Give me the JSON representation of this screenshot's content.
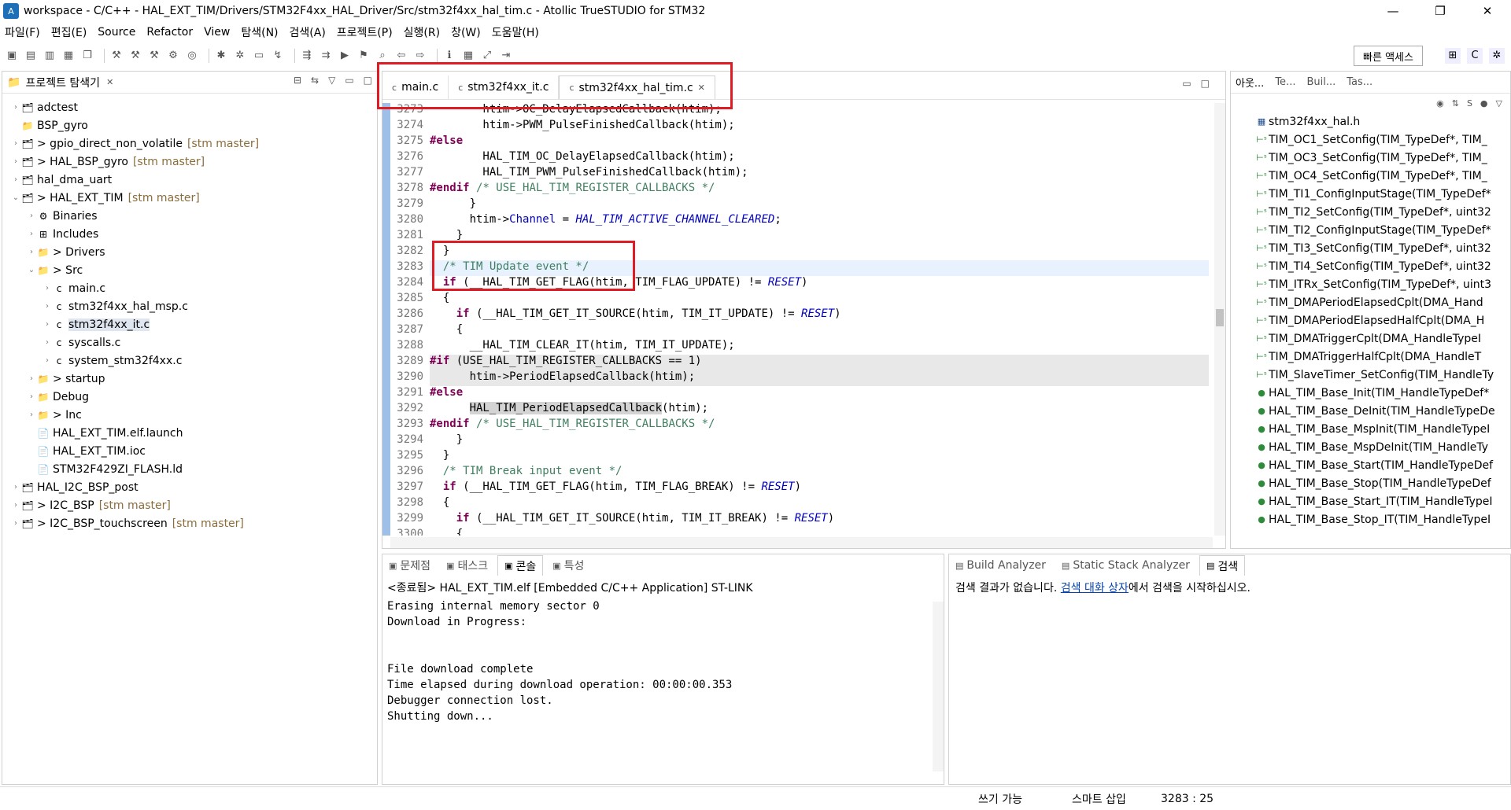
{
  "window": {
    "title": "workspace - C/C++ - HAL_EXT_TIM/Drivers/STM32F4xx_HAL_Driver/Src/stm32f4xx_hal_tim.c - Atollic TrueSTUDIO for STM32",
    "minimize": "—",
    "maximize": "❐",
    "close": "✕"
  },
  "menu": [
    "파일(F)",
    "편집(E)",
    "Source",
    "Refactor",
    "View",
    "탐색(N)",
    "검색(A)",
    "프로젝트(P)",
    "실행(R)",
    "창(W)",
    "도움말(H)"
  ],
  "toolbar": {
    "quick_access": "빠른 액세스"
  },
  "explorer": {
    "title": "프로젝트 탐색기",
    "items": [
      {
        "label": "adctest",
        "git": "",
        "arrow": "›",
        "icon": "project",
        "indent": 0
      },
      {
        "label": "BSP_gyro",
        "git": "",
        "arrow": "",
        "icon": "folder",
        "indent": 0
      },
      {
        "label": "> gpio_direct_non_volatile",
        "git": "[stm master]",
        "arrow": "›",
        "icon": "project",
        "indent": 0
      },
      {
        "label": "> HAL_BSP_gyro",
        "git": "[stm master]",
        "arrow": "›",
        "icon": "project",
        "indent": 0
      },
      {
        "label": "hal_dma_uart",
        "git": "",
        "arrow": "›",
        "icon": "project",
        "indent": 0
      },
      {
        "label": "> HAL_EXT_TIM",
        "git": "[stm master]",
        "arrow": "⌄",
        "icon": "project",
        "indent": 0
      },
      {
        "label": "Binaries",
        "git": "",
        "arrow": "›",
        "icon": "binaries",
        "indent": 1
      },
      {
        "label": "Includes",
        "git": "",
        "arrow": "›",
        "icon": "includes",
        "indent": 1
      },
      {
        "label": "> Drivers",
        "git": "",
        "arrow": "›",
        "icon": "folder",
        "indent": 1
      },
      {
        "label": "> Src",
        "git": "",
        "arrow": "⌄",
        "icon": "folder",
        "indent": 1
      },
      {
        "label": "main.c",
        "git": "",
        "arrow": "›",
        "icon": "cfile",
        "indent": 2
      },
      {
        "label": "stm32f4xx_hal_msp.c",
        "git": "",
        "arrow": "›",
        "icon": "cfile",
        "indent": 2
      },
      {
        "label": "stm32f4xx_it.c",
        "git": "",
        "arrow": "›",
        "icon": "cfile",
        "indent": 2,
        "selected": true
      },
      {
        "label": "syscalls.c",
        "git": "",
        "arrow": "›",
        "icon": "cfile",
        "indent": 2
      },
      {
        "label": "system_stm32f4xx.c",
        "git": "",
        "arrow": "›",
        "icon": "cfile",
        "indent": 2
      },
      {
        "label": "> startup",
        "git": "",
        "arrow": "›",
        "icon": "folder",
        "indent": 1
      },
      {
        "label": "Debug",
        "git": "",
        "arrow": "›",
        "icon": "folder",
        "indent": 1
      },
      {
        "label": "> Inc",
        "git": "",
        "arrow": "›",
        "icon": "folder",
        "indent": 1
      },
      {
        "label": "HAL_EXT_TIM.elf.launch",
        "git": "",
        "arrow": "",
        "icon": "file",
        "indent": 1
      },
      {
        "label": "HAL_EXT_TIM.ioc",
        "git": "",
        "arrow": "",
        "icon": "file",
        "indent": 1
      },
      {
        "label": "STM32F429ZI_FLASH.ld",
        "git": "",
        "arrow": "",
        "icon": "file",
        "indent": 1
      },
      {
        "label": "HAL_I2C_BSP_post",
        "git": "",
        "arrow": "›",
        "icon": "project",
        "indent": 0
      },
      {
        "label": "> I2C_BSP",
        "git": "[stm master]",
        "arrow": "›",
        "icon": "project",
        "indent": 0
      },
      {
        "label": "> I2C_BSP_touchscreen",
        "git": "[stm master]",
        "arrow": "›",
        "icon": "project",
        "indent": 0
      }
    ]
  },
  "editor": {
    "tabs": [
      {
        "label": "main.c",
        "active": false
      },
      {
        "label": "stm32f4xx_it.c",
        "active": false
      },
      {
        "label": "stm32f4xx_hal_tim.c",
        "active": true
      }
    ],
    "lines": [
      {
        "n": "3273",
        "html": "        htim->OC_DelayElapsedCallback(htim);",
        "hl": false
      },
      {
        "n": "3274",
        "html": "        htim->PWM_PulseFinishedCallback(htim);",
        "hl": false
      },
      {
        "n": "3275",
        "html": "<span class='pp'>#else</span>",
        "hl": false
      },
      {
        "n": "3276",
        "html": "        HAL_TIM_OC_DelayElapsedCallback(htim);",
        "hl": false
      },
      {
        "n": "3277",
        "html": "        HAL_TIM_PWM_PulseFinishedCallback(htim);",
        "hl": false
      },
      {
        "n": "3278",
        "html": "<span class='pp'>#endif</span> <span class='cm'>/* USE_HAL_TIM_REGISTER_CALLBACKS */</span>",
        "hl": false
      },
      {
        "n": "3279",
        "html": "      }",
        "hl": false
      },
      {
        "n": "3280",
        "html": "      htim-><span class='fld'>Channel</span> = <span class='mc'>HAL_TIM_ACTIVE_CHANNEL_CLEARED</span>;",
        "hl": false
      },
      {
        "n": "3281",
        "html": "    }",
        "hl": false
      },
      {
        "n": "3282",
        "html": "  }",
        "hl": false
      },
      {
        "n": "3283",
        "html": "  <span class='cm'>/* TIM Update event */</span>",
        "hl": false,
        "cur": true
      },
      {
        "n": "3284",
        "html": "  <span class='kw'>if</span> (__HAL_TIM_GET_FLAG(htim, TIM_FLAG_UPDATE) != <span class='mc'>RESET</span>)",
        "hl": false
      },
      {
        "n": "3285",
        "html": "  {",
        "hl": false
      },
      {
        "n": "3286",
        "html": "    <span class='kw'>if</span> (__HAL_TIM_GET_IT_SOURCE(htim, TIM_IT_UPDATE) != <span class='mc'>RESET</span>)",
        "hl": false
      },
      {
        "n": "3287",
        "html": "    {",
        "hl": false
      },
      {
        "n": "3288",
        "html": "      __HAL_TIM_CLEAR_IT(htim, TIM_IT_UPDATE);",
        "hl": false
      },
      {
        "n": "3289",
        "html": "<span class='pp'>#if</span> (USE_HAL_TIM_REGISTER_CALLBACKS == 1)",
        "hl": true
      },
      {
        "n": "3290",
        "html": "      htim->PeriodElapsedCallback(htim);",
        "hl": true
      },
      {
        "n": "3291",
        "html": "<span class='pp'>#else</span>",
        "hl": false
      },
      {
        "n": "3292",
        "html": "      <span style='background:#d4d4d4'>HAL_TIM_PeriodElapsedCallback</span>(htim);",
        "hl": false
      },
      {
        "n": "3293",
        "html": "<span class='pp'>#endif</span> <span class='cm'>/* USE_HAL_TIM_REGISTER_CALLBACKS */</span>",
        "hl": false
      },
      {
        "n": "3294",
        "html": "    }",
        "hl": false
      },
      {
        "n": "3295",
        "html": "  }",
        "hl": false
      },
      {
        "n": "3296",
        "html": "  <span class='cm'>/* TIM Break input event */</span>",
        "hl": false
      },
      {
        "n": "3297",
        "html": "  <span class='kw'>if</span> (__HAL_TIM_GET_FLAG(htim, TIM_FLAG_BREAK) != <span class='mc'>RESET</span>)",
        "hl": false
      },
      {
        "n": "3298",
        "html": "  {",
        "hl": false
      },
      {
        "n": "3299",
        "html": "    <span class='kw'>if</span> (__HAL_TIM_GET_IT_SOURCE(htim, TIM_IT_BREAK) != <span class='mc'>RESET</span>)",
        "hl": false
      },
      {
        "n": "3300",
        "html": "    {",
        "hl": false
      }
    ]
  },
  "outline": {
    "tabs": [
      "아웃...",
      "Te...",
      "Buil...",
      "Tas..."
    ],
    "items": [
      {
        "label": "stm32f4xx_hal.h",
        "type": "h"
      },
      {
        "label": "TIM_OC1_SetConfig(TIM_TypeDef*, TIM_",
        "type": "s"
      },
      {
        "label": "TIM_OC3_SetConfig(TIM_TypeDef*, TIM_",
        "type": "s"
      },
      {
        "label": "TIM_OC4_SetConfig(TIM_TypeDef*, TIM_",
        "type": "s"
      },
      {
        "label": "TIM_TI1_ConfigInputStage(TIM_TypeDef*",
        "type": "s"
      },
      {
        "label": "TIM_TI2_SetConfig(TIM_TypeDef*, uint32",
        "type": "s"
      },
      {
        "label": "TIM_TI2_ConfigInputStage(TIM_TypeDef*",
        "type": "s"
      },
      {
        "label": "TIM_TI3_SetConfig(TIM_TypeDef*, uint32",
        "type": "s"
      },
      {
        "label": "TIM_TI4_SetConfig(TIM_TypeDef*, uint32",
        "type": "s"
      },
      {
        "label": "TIM_ITRx_SetConfig(TIM_TypeDef*, uint3",
        "type": "s"
      },
      {
        "label": "TIM_DMAPeriodElapsedCplt(DMA_Hand",
        "type": "s"
      },
      {
        "label": "TIM_DMAPeriodElapsedHalfCplt(DMA_H",
        "type": "s"
      },
      {
        "label": "TIM_DMATriggerCplt(DMA_HandleTypeI",
        "type": "s"
      },
      {
        "label": "TIM_DMATriggerHalfCplt(DMA_HandleT",
        "type": "s"
      },
      {
        "label": "TIM_SlaveTimer_SetConfig(TIM_HandleTy",
        "type": "s"
      },
      {
        "label": "HAL_TIM_Base_Init(TIM_HandleTypeDef*",
        "type": "p"
      },
      {
        "label": "HAL_TIM_Base_DeInit(TIM_HandleTypeDe",
        "type": "p"
      },
      {
        "label": "HAL_TIM_Base_MspInit(TIM_HandleTypeI",
        "type": "p"
      },
      {
        "label": "HAL_TIM_Base_MspDeInit(TIM_HandleTy",
        "type": "p"
      },
      {
        "label": "HAL_TIM_Base_Start(TIM_HandleTypeDef",
        "type": "p"
      },
      {
        "label": "HAL_TIM_Base_Stop(TIM_HandleTypeDef",
        "type": "p"
      },
      {
        "label": "HAL_TIM_Base_Start_IT(TIM_HandleTypeI",
        "type": "p"
      },
      {
        "label": "HAL_TIM_Base_Stop_IT(TIM_HandleTypeI",
        "type": "p"
      }
    ]
  },
  "console": {
    "tabs": [
      "문제점",
      "태스크",
      "콘솔",
      "특성"
    ],
    "launch": "<종료됨> HAL_EXT_TIM.elf [Embedded C/C++ Application] ST-LINK",
    "output": "Erasing internal memory sector 0\nDownload in Progress:\n\n\nFile download complete\nTime elapsed during download operation: 00:00:00.353\nDebugger connection lost.\nShutting down..."
  },
  "search": {
    "tabs": [
      "Build Analyzer",
      "Static Stack Analyzer",
      "검색"
    ],
    "msg_before": "검색 결과가 없습니다. ",
    "msg_link": "검색 대화 상자",
    "msg_after": "에서 검색을 시작하십시오."
  },
  "status": {
    "writable": "쓰기 가능",
    "insert_mode": "스마트 삽입",
    "position": "3283 : 25"
  },
  "colors": {
    "highlight_box": "#e01b24",
    "gutter": "#9ec0e8"
  }
}
